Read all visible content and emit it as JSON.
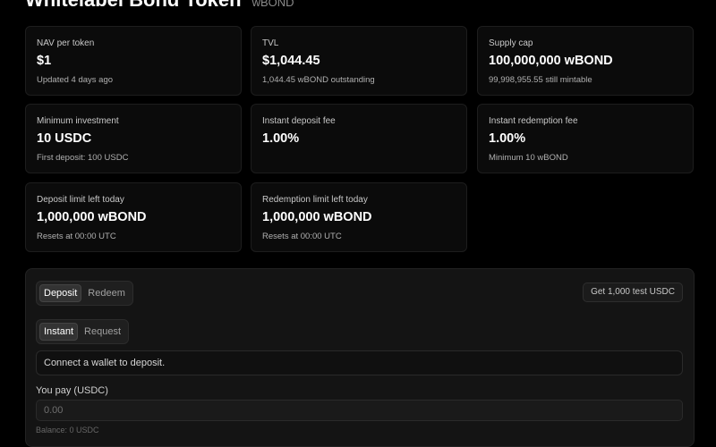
{
  "header": {
    "title": "Whitelabel Bond Token",
    "symbol": "wBOND"
  },
  "stats": [
    {
      "label": "NAV per token",
      "value": "$1",
      "sub": "Updated 4 days ago"
    },
    {
      "label": "TVL",
      "value": "$1,044.45",
      "sub": "1,044.45 wBOND outstanding"
    },
    {
      "label": "Supply cap",
      "value": "100,000,000 wBOND",
      "sub": "99,998,955.55 still mintable"
    },
    {
      "label": "Minimum investment",
      "value": "10 USDC",
      "sub": "First deposit: 100 USDC"
    },
    {
      "label": "Instant deposit fee",
      "value": "1.00%",
      "sub": ""
    },
    {
      "label": "Instant redemption fee",
      "value": "1.00%",
      "sub": "Minimum 10 wBOND"
    },
    {
      "label": "Deposit limit left today",
      "value": "1,000,000 wBOND",
      "sub": "Resets at 00:00 UTC"
    },
    {
      "label": "Redemption limit left today",
      "value": "1,000,000 wBOND",
      "sub": "Resets at 00:00 UTC"
    }
  ],
  "panel": {
    "mode_tabs": [
      "Deposit",
      "Redeem"
    ],
    "type_tabs": [
      "Instant",
      "Request"
    ],
    "test_button": "Get 1,000 test USDC",
    "notice": "Connect a wallet to deposit.",
    "pay_label": "You pay (USDC)",
    "pay_placeholder": "0.00",
    "balance": "Balance: 0 USDC"
  }
}
